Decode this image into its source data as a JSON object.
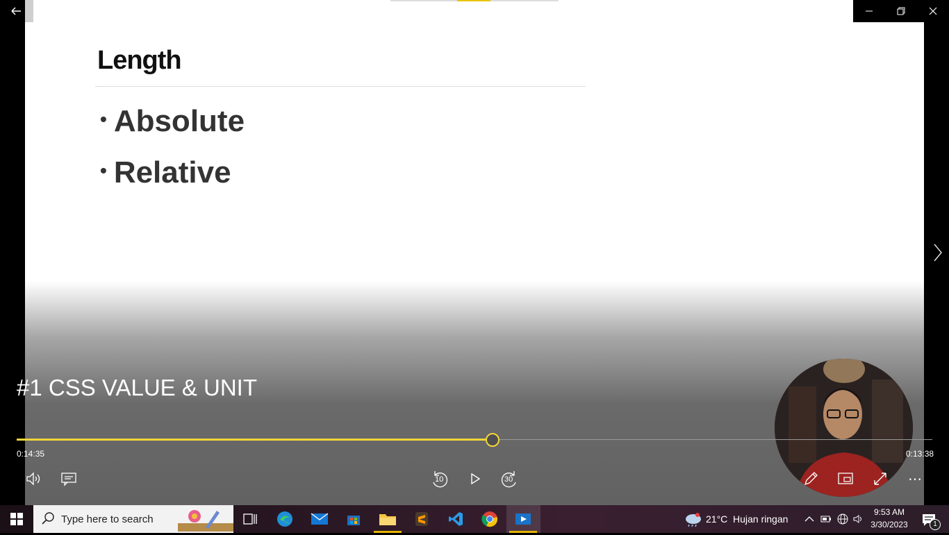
{
  "slide": {
    "title": "Length",
    "bullets": [
      "Absolute",
      "Relative"
    ],
    "bullet_char": "•"
  },
  "player": {
    "video_title": "#1 CSS VALUE & UNIT",
    "elapsed": "0:14:35",
    "remaining": "0:13:38",
    "progress_fraction": 0.52,
    "accent_color": "#f3d63a",
    "skip_back_label": "10",
    "skip_forward_label": "30",
    "more_label": "⋯"
  },
  "taskbar": {
    "search_placeholder": "Type here to search",
    "weather_temp": "21°C",
    "weather_desc": "Hujan ringan",
    "time": "9:53 AM",
    "date": "3/30/2023",
    "notification_count": "1"
  }
}
